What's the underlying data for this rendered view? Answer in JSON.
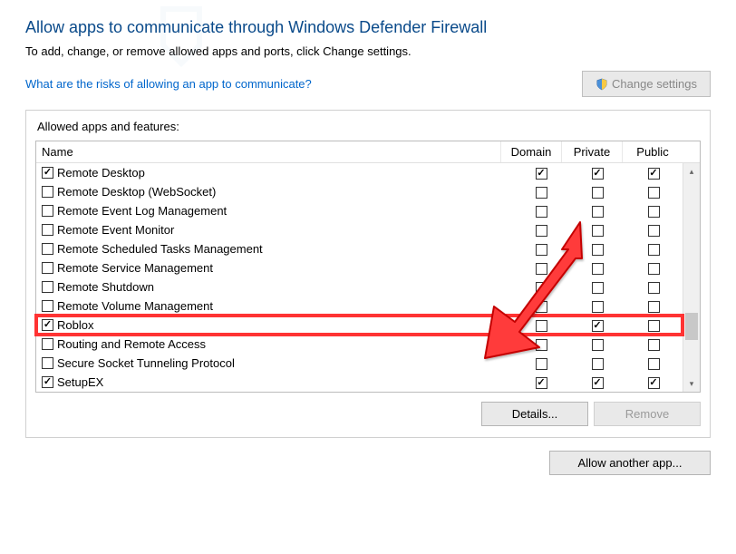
{
  "title": "Allow apps to communicate through Windows Defender Firewall",
  "subtitle": "To add, change, or remove allowed apps and ports, click Change settings.",
  "risks_link": "What are the risks of allowing an app to communicate?",
  "change_settings_btn": "Change settings",
  "group_label": "Allowed apps and features:",
  "columns": {
    "name": "Name",
    "domain": "Domain",
    "private": "Private",
    "public": "Public"
  },
  "rows": [
    {
      "enabled": true,
      "name": "Remote Desktop",
      "domain": true,
      "private": true,
      "public": true,
      "highlight": false
    },
    {
      "enabled": false,
      "name": "Remote Desktop (WebSocket)",
      "domain": false,
      "private": false,
      "public": false,
      "highlight": false
    },
    {
      "enabled": false,
      "name": "Remote Event Log Management",
      "domain": false,
      "private": false,
      "public": false,
      "highlight": false
    },
    {
      "enabled": false,
      "name": "Remote Event Monitor",
      "domain": false,
      "private": false,
      "public": false,
      "highlight": false
    },
    {
      "enabled": false,
      "name": "Remote Scheduled Tasks Management",
      "domain": false,
      "private": false,
      "public": false,
      "highlight": false
    },
    {
      "enabled": false,
      "name": "Remote Service Management",
      "domain": false,
      "private": false,
      "public": false,
      "highlight": false
    },
    {
      "enabled": false,
      "name": "Remote Shutdown",
      "domain": false,
      "private": false,
      "public": false,
      "highlight": false
    },
    {
      "enabled": false,
      "name": "Remote Volume Management",
      "domain": false,
      "private": false,
      "public": false,
      "highlight": false
    },
    {
      "enabled": true,
      "name": "Roblox",
      "domain": false,
      "private": true,
      "public": false,
      "highlight": true
    },
    {
      "enabled": false,
      "name": "Routing and Remote Access",
      "domain": false,
      "private": false,
      "public": false,
      "highlight": false
    },
    {
      "enabled": false,
      "name": "Secure Socket Tunneling Protocol",
      "domain": false,
      "private": false,
      "public": false,
      "highlight": false
    },
    {
      "enabled": true,
      "name": "SetupEX",
      "domain": true,
      "private": true,
      "public": true,
      "highlight": false
    }
  ],
  "details_btn": "Details...",
  "remove_btn": "Remove",
  "allow_another_btn": "Allow another app..."
}
